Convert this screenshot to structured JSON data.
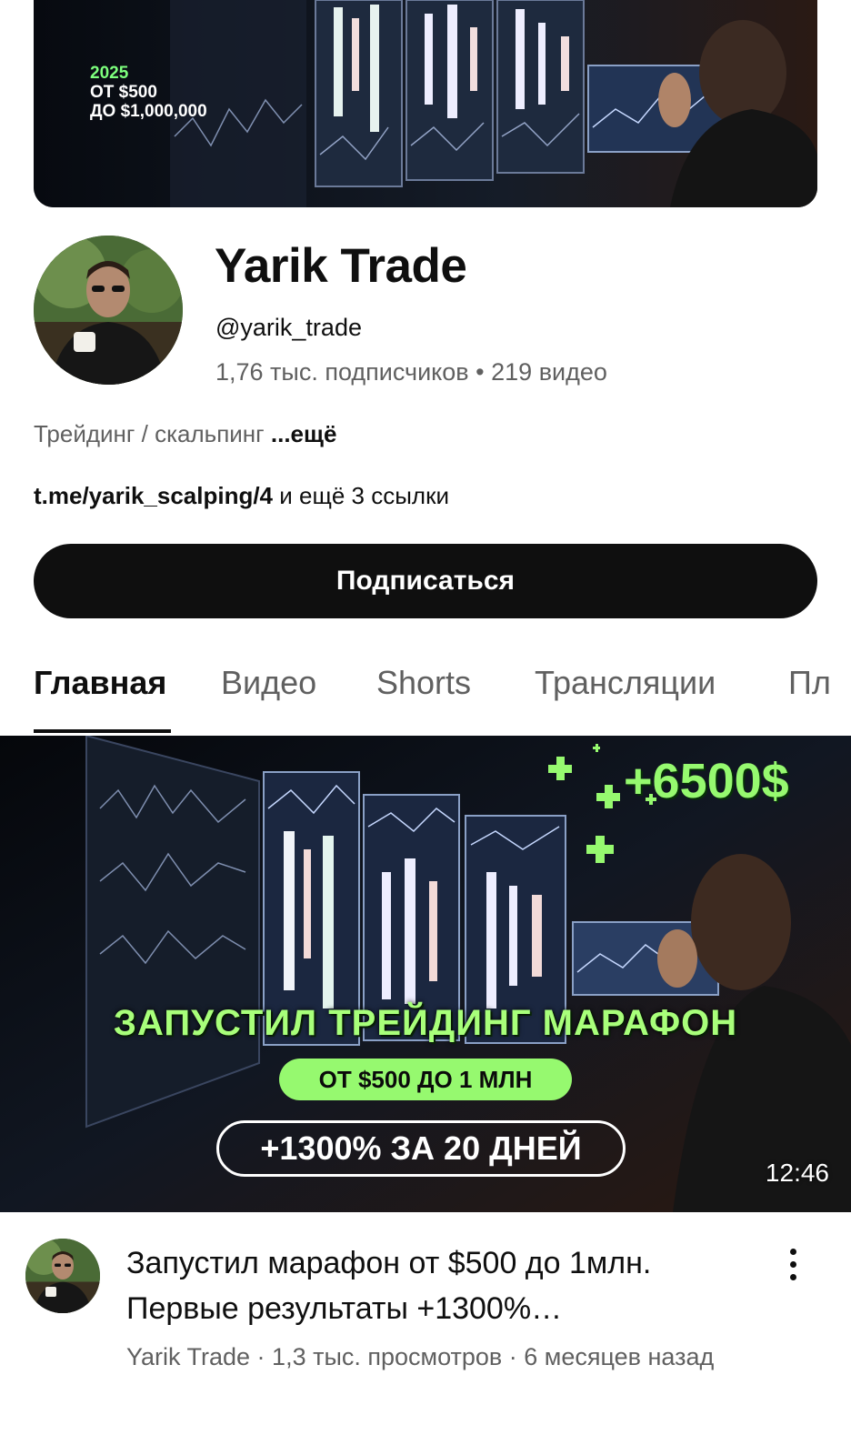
{
  "banner": {
    "year": "2025",
    "line1": "ОТ $500",
    "line2": "ДО $1,000,000"
  },
  "channel": {
    "name": "Yarik Trade",
    "handle": "@yarik_trade",
    "subscribers": "1,76 тыс. подписчиков",
    "separator": "•",
    "videos": "219 видео",
    "description": "Трейдинг / скальпинг",
    "description_more": "...ещё",
    "link_main": "t.me/yarik_scalping/4",
    "link_more": "и ещё 3 ссылки",
    "subscribe_label": "Подписаться"
  },
  "tabs": [
    {
      "label": "Главная",
      "active": true
    },
    {
      "label": "Видео",
      "active": false
    },
    {
      "label": "Shorts",
      "active": false
    },
    {
      "label": "Трансляции",
      "active": false
    },
    {
      "label": "Пл",
      "active": false
    }
  ],
  "video": {
    "thumb_money": "+6500$",
    "thumb_headline": "ЗАПУСТИЛ ТРЕЙДИНГ МАРАФОН",
    "thumb_pill": "ОТ $500 ДО 1 МЛН",
    "thumb_outline": "+1300% ЗА 20 ДНЕЙ",
    "duration": "12:46",
    "title": "Запустил марафон от $500 до 1млн. Первые результаты +1300%…",
    "meta": "Yarik Trade · 1,3 тыс. просмотров · 6 месяцев назад"
  },
  "colors": {
    "accent_green": "#96f96f",
    "text_primary": "#0f0f0f",
    "text_secondary": "#606060",
    "button_bg": "#0f0f0f"
  }
}
